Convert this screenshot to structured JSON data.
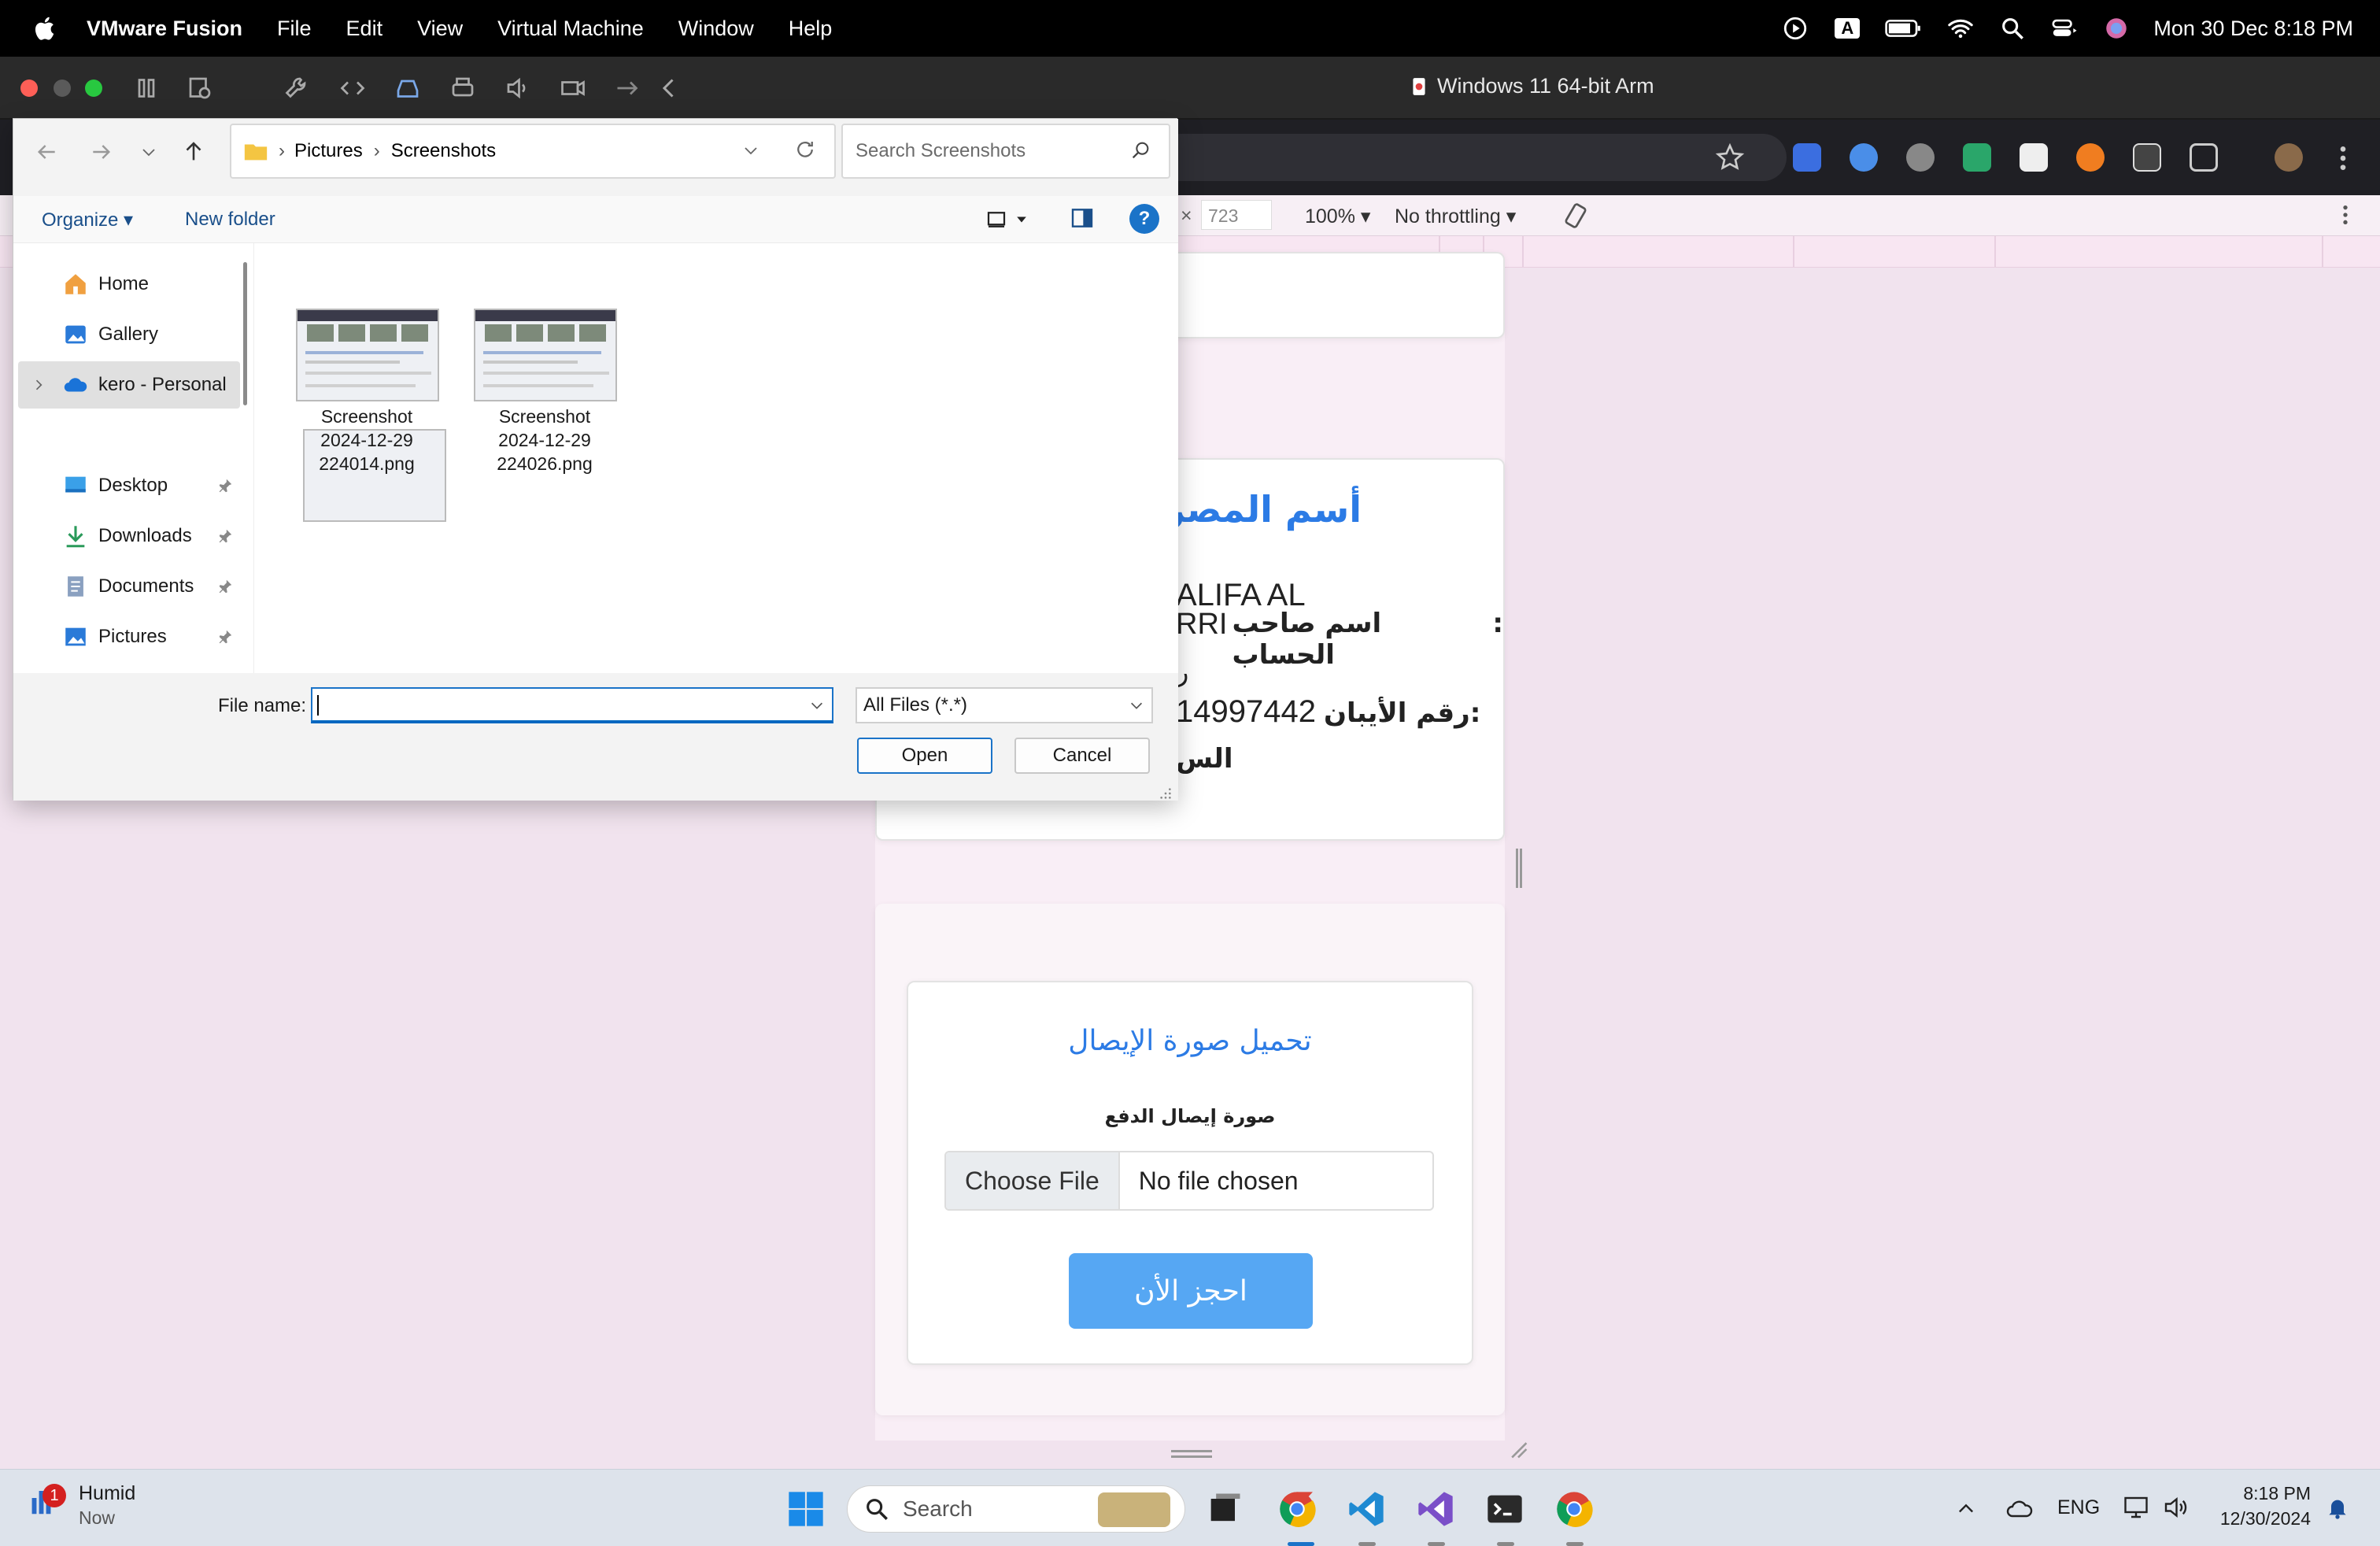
{
  "menubar": {
    "app_name": "VMware Fusion",
    "items": [
      "File",
      "Edit",
      "View",
      "Virtual Machine",
      "Window",
      "Help"
    ],
    "input_indicator": "A",
    "clock": "Mon 30 Dec  8:18 PM"
  },
  "vm": {
    "window_title": "Windows 11 64-bit Arm"
  },
  "devtools": {
    "times": "×",
    "height": "723",
    "zoom": "100% ▾",
    "throttling": "No throttling ▾"
  },
  "page": {
    "bank_heading": "أسم المصرف",
    "holder_text": "اسم صاحب الحساب: ...ALIFA AL ...RRI",
    "holder_value": "ALIFA AL",
    "holder_label": "اسم صاحب الحساب",
    "holder_rri": "RRI",
    "iban_label": "رقم الأيبان:",
    "iban_value": "14997442",
    "partial_1": "ر",
    "partial_2": "الس",
    "upload_title": "تحميل صورة الإيصال",
    "receipt_label": "صورة إيصال الدفع",
    "choose_file": "Choose File",
    "no_file": "No file chosen",
    "book_now": "احجز الأن"
  },
  "dialog": {
    "breadcrumb": [
      "Pictures",
      "Screenshots"
    ],
    "search_placeholder": "Search Screenshots",
    "organize": "Organize ▾",
    "new_folder": "New folder",
    "sidebar": {
      "home": "Home",
      "gallery": "Gallery",
      "onedrive": "kero - Personal",
      "desktop": "Desktop",
      "downloads": "Downloads",
      "documents": "Documents",
      "pictures": "Pictures"
    },
    "files": [
      {
        "line1": "Screenshot",
        "line2": "2024-12-29",
        "line3": "224014.png"
      },
      {
        "line1": "Screenshot",
        "line2": "2024-12-29",
        "line3": "224026.png"
      }
    ],
    "file_name_label": "File name:",
    "file_name_value": "",
    "file_type": "All Files (*.*)",
    "open": "Open",
    "cancel": "Cancel"
  },
  "taskbar": {
    "weather_title": "Humid",
    "weather_sub": "Now",
    "weather_badge": "1",
    "search": "Search",
    "lang": "ENG",
    "time": "8:18 PM",
    "date": "12/30/2024"
  },
  "colors": {
    "accent_blue": "#1a73c8",
    "page_bg": "#f1e3ee",
    "book_button": "#56a7f3",
    "heading_blue": "#2c7be5"
  }
}
